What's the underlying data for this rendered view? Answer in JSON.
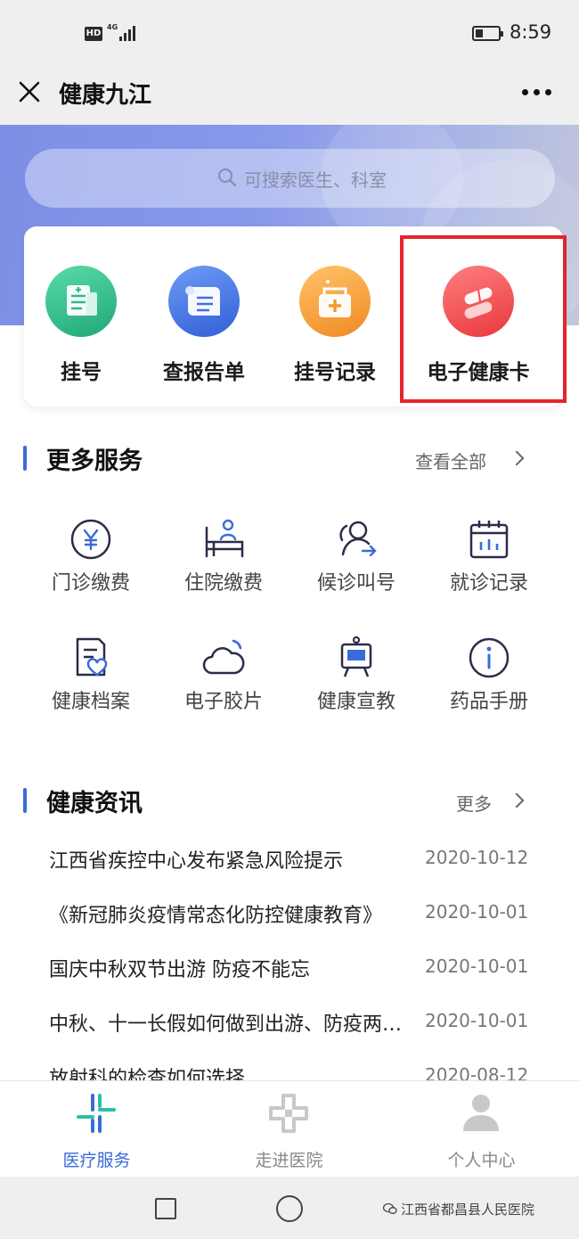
{
  "status_bar": {
    "hd_badge": "HD",
    "network": "4G",
    "battery_level": 0.35,
    "time": "8:59"
  },
  "title_bar": {
    "title": "健康九江",
    "close_icon": "close-icon",
    "more_icon": "more-icon"
  },
  "search": {
    "placeholder": "可搜索医生、科室",
    "icon": "search-icon"
  },
  "quick_actions": [
    {
      "label": "挂号",
      "icon": "register-icon",
      "color": "#2fb98a"
    },
    {
      "label": "查报告单",
      "icon": "report-icon",
      "color": "#3f6fe0"
    },
    {
      "label": "挂号记录",
      "icon": "record-icon",
      "color": "#f39a33"
    },
    {
      "label": "电子健康卡",
      "icon": "pill-icon",
      "color": "#ee4b4b",
      "highlighted": true
    }
  ],
  "more_services": {
    "title": "更多服务",
    "view_all": "查看全部",
    "items": [
      {
        "label": "门诊缴费",
        "icon": "yen-icon"
      },
      {
        "label": "住院缴费",
        "icon": "hospital-bed-icon"
      },
      {
        "label": "候诊叫号",
        "icon": "queue-icon"
      },
      {
        "label": "就诊记录",
        "icon": "calendar-icon"
      },
      {
        "label": "健康档案",
        "icon": "health-file-icon"
      },
      {
        "label": "电子胶片",
        "icon": "cloud-icon"
      },
      {
        "label": "健康宣教",
        "icon": "easel-icon"
      },
      {
        "label": "药品手册",
        "icon": "info-icon"
      }
    ]
  },
  "news": {
    "title": "健康资讯",
    "more": "更多",
    "items": [
      {
        "title": "江西省疾控中心发布紧急风险提示",
        "date": "2020-10-12"
      },
      {
        "title": "《新冠肺炎疫情常态化防控健康教育》",
        "date": "2020-10-01"
      },
      {
        "title": "国庆中秋双节出游 防疫不能忘",
        "date": "2020-10-01"
      },
      {
        "title": "中秋、十一长假如何做到出游、防疫两不误",
        "date": "2020-10-01"
      },
      {
        "title": "放射科的检查如何选择",
        "date": "2020-08-12"
      }
    ]
  },
  "tab_bar": [
    {
      "label": "医疗服务",
      "icon": "medical-service-icon",
      "active": true
    },
    {
      "label": "走进医院",
      "icon": "hospital-cross-icon",
      "active": false
    },
    {
      "label": "个人中心",
      "icon": "person-icon",
      "active": false
    }
  ],
  "watermark": "江西省都昌县人民医院",
  "colors": {
    "accent": "#3a6bd8",
    "highlight_border": "#e5242c",
    "banner": "#8899ea"
  }
}
